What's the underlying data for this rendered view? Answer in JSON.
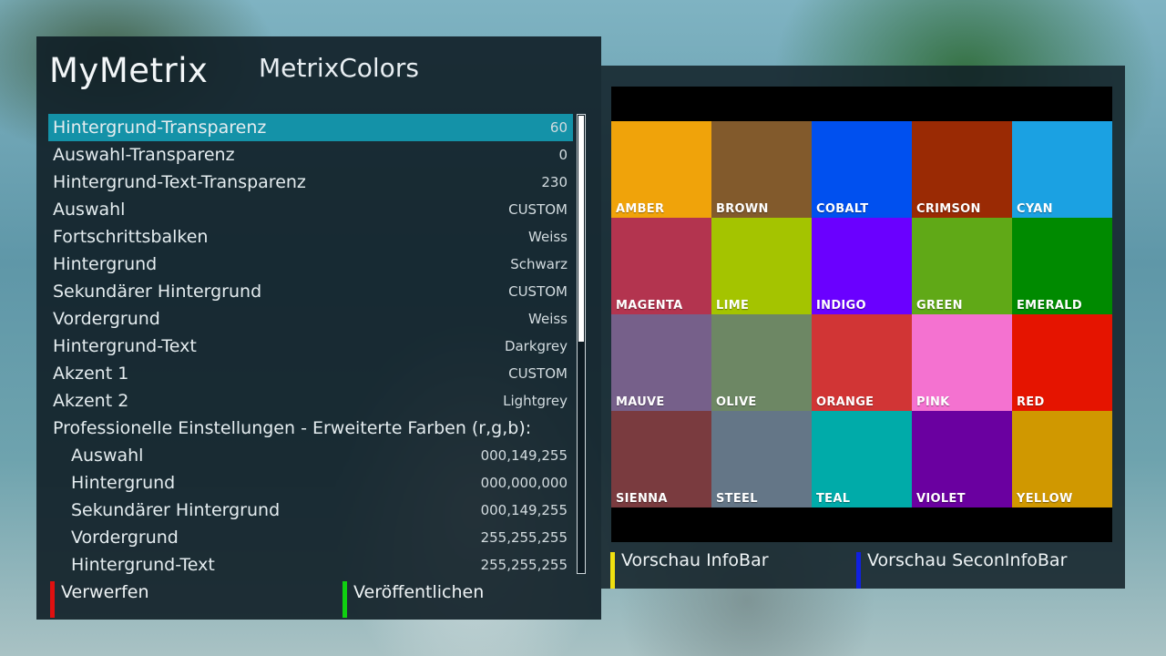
{
  "header": {
    "brand": "MyMetrix",
    "title": "MetrixColors"
  },
  "settings": [
    {
      "label": "Hintergrund-Transparenz",
      "value": "60",
      "selected": true
    },
    {
      "label": "Auswahl-Transparenz",
      "value": "0"
    },
    {
      "label": "Hintergrund-Text-Transparenz",
      "value": "230"
    },
    {
      "label": "Auswahl",
      "value": "CUSTOM"
    },
    {
      "label": "Fortschrittsbalken",
      "value": "Weiss"
    },
    {
      "label": "Hintergrund",
      "value": "Schwarz"
    },
    {
      "label": "Sekundärer Hintergrund",
      "value": "CUSTOM"
    },
    {
      "label": "Vordergrund",
      "value": "Weiss"
    },
    {
      "label": "Hintergrund-Text",
      "value": "Darkgrey"
    },
    {
      "label": "Akzent 1",
      "value": "CUSTOM"
    },
    {
      "label": "Akzent 2",
      "value": "Lightgrey"
    },
    {
      "label": "Professionelle Einstellungen - Erweiterte Farben (r,g,b):",
      "value": ""
    },
    {
      "label": "Auswahl",
      "value": "000,149,255",
      "sub": true
    },
    {
      "label": "Hintergrund",
      "value": "000,000,000",
      "sub": true
    },
    {
      "label": "Sekundärer Hintergrund",
      "value": "000,149,255",
      "sub": true
    },
    {
      "label": "Vordergrund",
      "value": "255,255,255",
      "sub": true
    },
    {
      "label": "Hintergrund-Text",
      "value": "255,255,255",
      "sub": true
    }
  ],
  "buttons": {
    "red": {
      "label": "Verwerfen",
      "color": "#e01010"
    },
    "green": {
      "label": "Veröffentlichen",
      "color": "#10d010"
    },
    "yellow": {
      "label": "Vorschau InfoBar",
      "color": "#f0e010"
    },
    "blue": {
      "label": "Vorschau SeconInfoBar",
      "color": "#1020e0"
    }
  },
  "swatches": [
    {
      "name": "AMBER",
      "color": "#f0a30a"
    },
    {
      "name": "BROWN",
      "color": "#825a2c"
    },
    {
      "name": "COBALT",
      "color": "#0050ef"
    },
    {
      "name": "CRIMSON",
      "color": "#9a2a04"
    },
    {
      "name": "CYAN",
      "color": "#1ba1e2"
    },
    {
      "name": "MAGENTA",
      "color": "#b3344f"
    },
    {
      "name": "LIME",
      "color": "#a4c400"
    },
    {
      "name": "INDIGO",
      "color": "#6a00ff"
    },
    {
      "name": "GREEN",
      "color": "#60a917"
    },
    {
      "name": "EMERALD",
      "color": "#008a00"
    },
    {
      "name": "MAUVE",
      "color": "#76608a"
    },
    {
      "name": "OLIVE",
      "color": "#6d8764"
    },
    {
      "name": "ORANGE",
      "color": "#d13535"
    },
    {
      "name": "PINK",
      "color": "#f472d0"
    },
    {
      "name": "RED",
      "color": "#e51400"
    },
    {
      "name": "SIENNA",
      "color": "#7a3b3f"
    },
    {
      "name": "STEEL",
      "color": "#647687"
    },
    {
      "name": "TEAL",
      "color": "#00aba9"
    },
    {
      "name": "VIOLET",
      "color": "#6a00a0"
    },
    {
      "name": "YELLOW",
      "color": "#d09800"
    }
  ]
}
